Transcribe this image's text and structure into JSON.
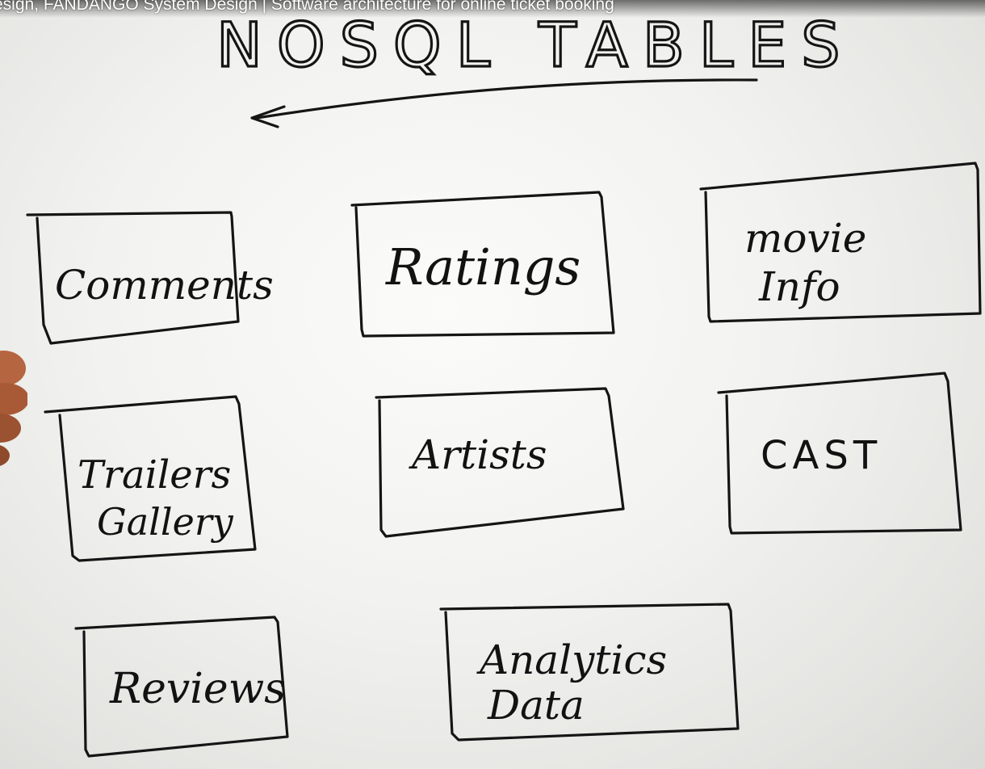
{
  "video": {
    "title_overlay": "esign, FANDANGO System Design | Software architecture for online ticket booking"
  },
  "whiteboard": {
    "heading": "NOSQL TABLES",
    "tables": [
      {
        "id": "comments",
        "lines": [
          "Comments"
        ]
      },
      {
        "id": "ratings",
        "lines": [
          "Ratings"
        ]
      },
      {
        "id": "movie-info",
        "lines": [
          "movie",
          "Info"
        ]
      },
      {
        "id": "trailers-gallery",
        "lines": [
          "Trailers",
          "Gallery"
        ]
      },
      {
        "id": "artists",
        "lines": [
          "Artists"
        ]
      },
      {
        "id": "cast",
        "lines": [
          "CAST"
        ]
      },
      {
        "id": "reviews",
        "lines": [
          "Reviews"
        ]
      },
      {
        "id": "analytics-data",
        "lines": [
          "Analytics",
          "Data"
        ]
      }
    ]
  },
  "colors": {
    "ink": "#151515",
    "board": "#f4f4f2",
    "skin": "#b5653f"
  }
}
